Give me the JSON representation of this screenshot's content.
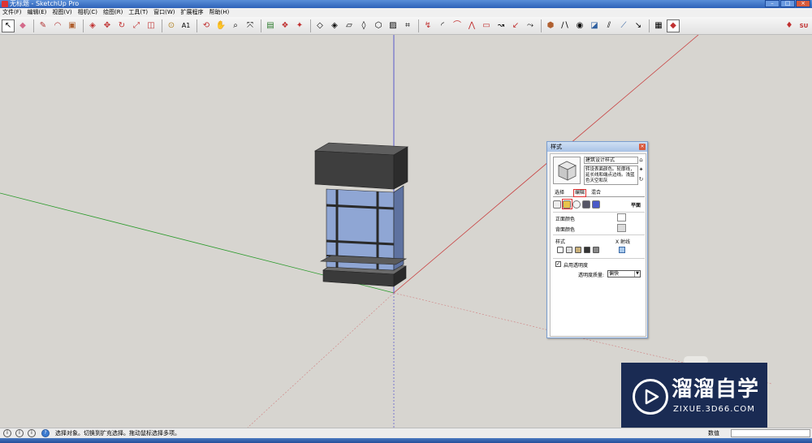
{
  "window": {
    "title": "无标题 - SketchUp Pro",
    "controls": [
      "minimize",
      "maximize",
      "close"
    ]
  },
  "menu": [
    "文件(F)",
    "编辑(E)",
    "视图(V)",
    "相机(C)",
    "绘图(R)",
    "工具(T)",
    "窗口(W)",
    "扩展程序",
    "帮助(H)"
  ],
  "toolbar": {
    "groups": [
      [
        "select-tool",
        "eraser-tool"
      ],
      [
        "line-tool",
        "arc-tool",
        "shape-tool"
      ],
      [
        "push-pull-tool",
        "move-tool",
        "rotate-tool",
        "scale-tool",
        "offset-tool"
      ],
      [
        "tape-measure-tool",
        "text-tool"
      ],
      [
        "orbit-tool",
        "pan-tool",
        "zoom-tool",
        "zoom-extents-tool"
      ],
      [
        "warehouse-tool",
        "components-tool",
        "extension-tool"
      ],
      [
        "sandbox-tool-1",
        "sandbox-tool-2",
        "sandbox-tool-3",
        "sandbox-tool-4",
        "sandbox-tool-5",
        "sandbox-tool-6",
        "sandbox-tool-7"
      ],
      [
        "solid-tool-1",
        "solid-tool-2",
        "solid-tool-3",
        "solid-tool-4",
        "solid-tool-5",
        "solid-tool-6",
        "solid-tool-7",
        "solid-tool-8"
      ],
      [
        "view-tool-1",
        "view-tool-2",
        "view-tool-3",
        "view-tool-4",
        "view-tool-5",
        "view-tool-6",
        "view-tool-7"
      ],
      [
        "style-tool",
        "ruby-tool"
      ]
    ],
    "far_right": [
      "ruby-icon",
      "su-icon"
    ]
  },
  "styles_dialog": {
    "title": "样式",
    "style_name": "建筑设计样式",
    "description": "转设表面颜色。轮廓线，延长线和端点边线。浅蓝色天空和灰",
    "tabs": [
      "选择",
      "编辑",
      "混合"
    ],
    "active_tab": "编辑",
    "plane_label": "平面",
    "front_color_label": "正面颜色",
    "back_color_label": "背面颜色",
    "style_section_label": "样式",
    "xray_label": "X 射线",
    "transparency_label": "启用透明度",
    "transparency_checked": true,
    "quality_label": "透明度质量:",
    "quality_value": "偏快"
  },
  "status": {
    "text": "选择对象。切换到扩充选择。拖动鼠标选择多项。",
    "measure_label": "数值",
    "measure_value": ""
  },
  "watermark": {
    "title": "溜溜自学",
    "subtitle": "ZIXUE.3D66.COM"
  }
}
